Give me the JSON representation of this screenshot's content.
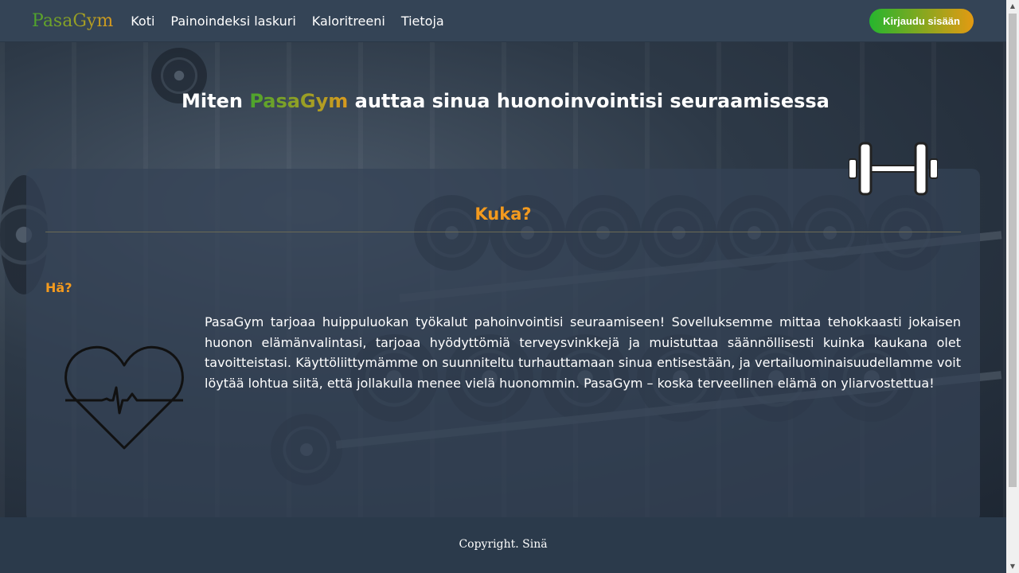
{
  "nav": {
    "brand": "PasaGym",
    "links": [
      "Koti",
      "Painoindeksi laskuri",
      "Kaloritreeni",
      "Tietoja"
    ],
    "login_label": "Kirjaudu sisään"
  },
  "hero": {
    "headline_before": "Miten ",
    "headline_accent": "PasaGym",
    "headline_after": " auttaa sinua huonoinvointisi seuraamisessa"
  },
  "card": {
    "title": "Kuka?",
    "subheading": "Hä?",
    "description": "PasaGym tarjoaa huippuluokan työkalut pahoinvointisi seuraamiseen! Sovelluksemme mittaa tehokkaasti jokaisen huonon elämänvalintasi, tarjoaa hyödyttömiä terveysvinkkejä ja muistuttaa säännöllisesti kuinka kaukana olet tavoitteistasi. Käyttöliittymämme on suunniteltu turhauttamaan sinua entisestään, ja vertailuominaisuudellamme voit löytää lohtua siitä, että jollakulla menee vielä huonommin. PasaGym – koska terveellinen elämä on yliarvostettua!"
  },
  "footer": {
    "copyright": "Copyright. Sinä"
  },
  "colors": {
    "accent_orange": "#f39a1e",
    "brand_green": "#4aa52d",
    "brand_gold": "#d99a1e",
    "navbar_bg": "#344456"
  },
  "icons": {
    "dumbbell": "dumbbell-icon",
    "heart": "heartbeat-icon"
  }
}
